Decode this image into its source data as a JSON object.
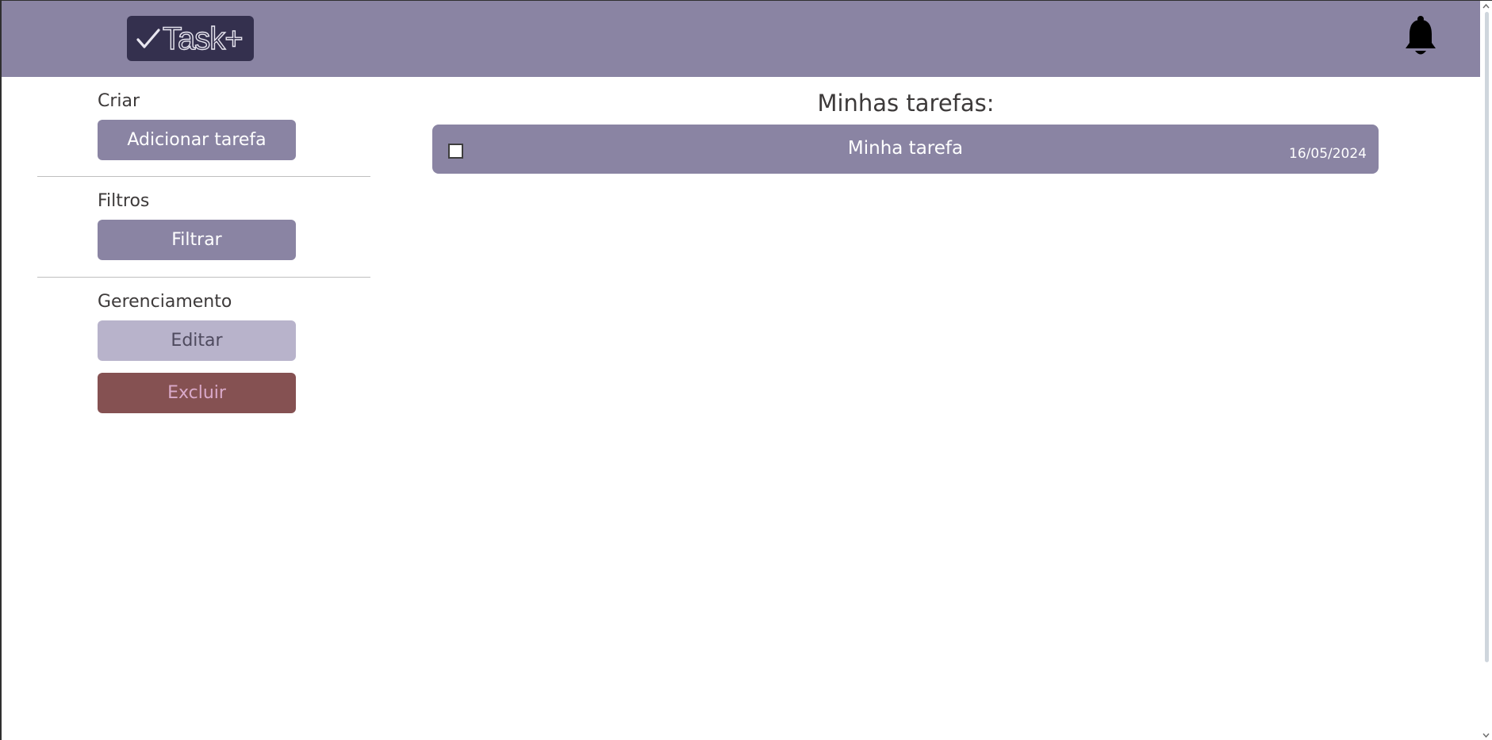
{
  "header": {
    "logo_text": "Task+",
    "logo_icon": "check-icon",
    "notification_icon": "bell-icon"
  },
  "sidebar": {
    "create_label": "Criar",
    "add_task_button": "Adicionar tarefa",
    "filters_label": "Filtros",
    "filter_button": "Filtrar",
    "management_label": "Gerenciamento",
    "edit_button": "Editar",
    "delete_button": "Excluir"
  },
  "main": {
    "title": "Minhas tarefas:",
    "tasks": [
      {
        "title": "Minha tarefa",
        "date": "16/05/2024",
        "checked": false
      }
    ]
  },
  "colors": {
    "primary": "#8a84a3",
    "logo_bg": "#34304e",
    "disabled": "#b8b3cb",
    "danger": "#855152"
  }
}
